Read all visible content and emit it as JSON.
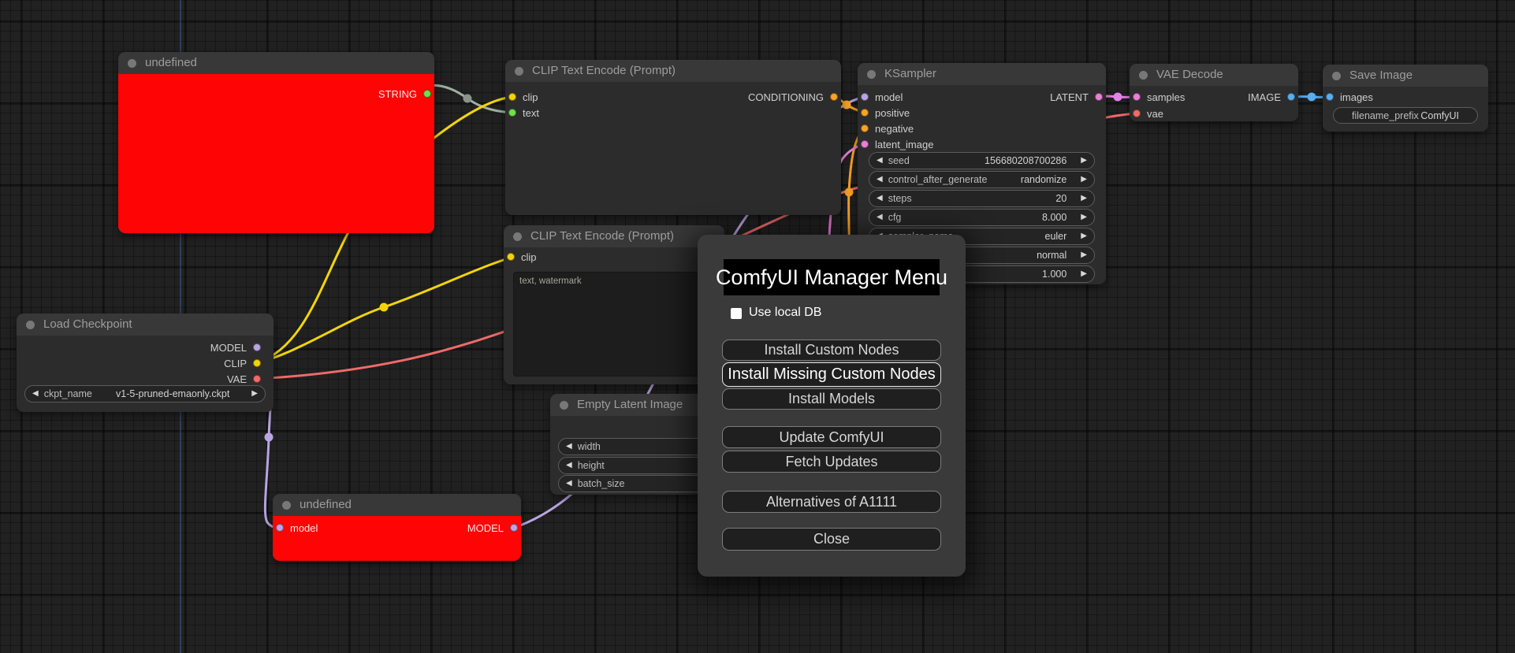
{
  "dialog": {
    "title": "ComfyUI Manager Menu",
    "use_local_db_label": "Use local DB",
    "buttons": {
      "install_custom_nodes": "Install Custom Nodes",
      "install_missing_custom_nodes": "Install Missing Custom Nodes",
      "install_models": "Install Models",
      "update_comfyui": "Update ComfyUI",
      "fetch_updates": "Fetch Updates",
      "alternatives_a1111": "Alternatives of A1111",
      "close": "Close"
    }
  },
  "nodes": {
    "string_node": {
      "title": "undefined",
      "outputs": {
        "string": "STRING"
      }
    },
    "clip_encode_positive": {
      "title": "CLIP Text Encode (Prompt)",
      "inputs": {
        "clip": "clip",
        "text": "text"
      },
      "outputs": {
        "conditioning": "CONDITIONING"
      }
    },
    "clip_encode_negative": {
      "title": "CLIP Text Encode (Prompt)",
      "inputs": {
        "clip": "clip"
      },
      "text_value": "text, watermark"
    },
    "ksampler": {
      "title": "KSampler",
      "inputs": {
        "model": "model",
        "positive": "positive",
        "negative": "negative",
        "latent_image": "latent_image"
      },
      "outputs": {
        "latent": "LATENT"
      },
      "widgets": [
        {
          "label": "seed",
          "value": "156680208700286"
        },
        {
          "label": "control_after_generate",
          "value": "randomize"
        },
        {
          "label": "steps",
          "value": "20"
        },
        {
          "label": "cfg",
          "value": "8.000"
        },
        {
          "label": "sampler_name",
          "value": "euler"
        },
        {
          "label": "",
          "value": "normal"
        },
        {
          "label": "",
          "value": "1.000"
        }
      ]
    },
    "load_checkpoint": {
      "title": "Load Checkpoint",
      "outputs": {
        "model": "MODEL",
        "clip": "CLIP",
        "vae": "VAE"
      },
      "widgets": [
        {
          "label": "ckpt_name",
          "value": "v1-5-pruned-emaonly.ckpt"
        }
      ]
    },
    "vae_decode": {
      "title": "VAE Decode",
      "inputs": {
        "samples": "samples",
        "vae": "vae"
      },
      "outputs": {
        "image": "IMAGE"
      }
    },
    "save_image": {
      "title": "Save Image",
      "inputs": {
        "images": "images"
      },
      "widgets": [
        {
          "label": "filename_prefix",
          "value": "ComfyUI"
        }
      ]
    },
    "model_patch_node": {
      "title": "undefined",
      "inputs": {
        "model": "model"
      },
      "outputs": {
        "model": "MODEL"
      }
    },
    "empty_latent": {
      "title": "Empty Latent Image",
      "widgets": [
        {
          "label": "width"
        },
        {
          "label": "height"
        },
        {
          "label": "batch_size"
        }
      ]
    }
  },
  "colors": {
    "error_node_body": "#fe0404",
    "link_clip": "#f2d40b",
    "link_model": "#b9a5e3",
    "link_vae": "#f16a6a",
    "link_conditioning": "#f7a325",
    "link_latent": "#e97fd7",
    "link_image": "#58aef0",
    "link_string": "#9fb09f",
    "port_text_green": "#6ee24a",
    "dialog_bg": "#3a3a3a"
  }
}
